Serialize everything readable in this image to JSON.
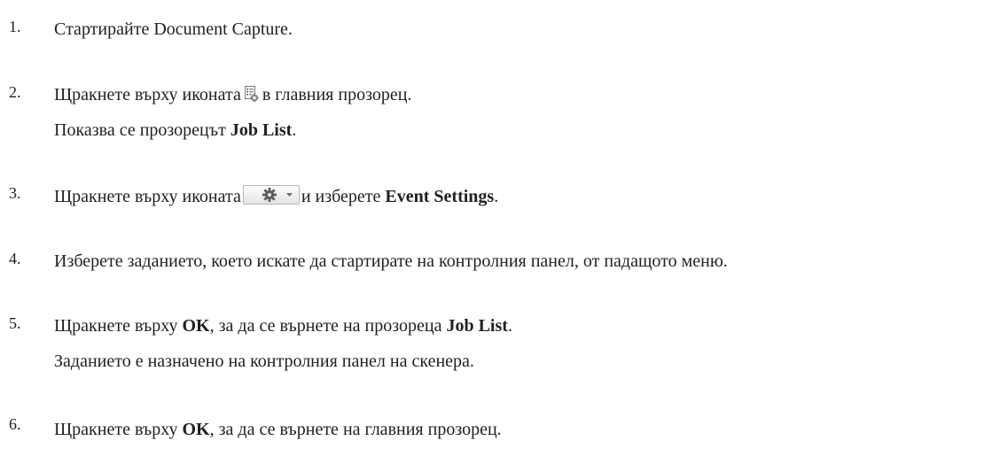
{
  "steps": [
    {
      "number": "1.",
      "text": "Стартирайте Document Capture."
    },
    {
      "number": "2.",
      "line1": {
        "before": "Щракнете върху иконата",
        "icon": "job-list-icon",
        "after": "в главния прозорец."
      },
      "line2": {
        "before": "Показва се прозорецът ",
        "bold": "Job List",
        "after": "."
      }
    },
    {
      "number": "3.",
      "line1": {
        "before": "Щракнете върху иконата",
        "icon": "gear-dropdown-icon",
        "after_plain": "и изберете ",
        "bold": "Event Settings",
        "after": "."
      }
    },
    {
      "number": "4.",
      "text": "Изберете заданието, което искате да стартирате на контролния панел, от падащото меню."
    },
    {
      "number": "5.",
      "line1": {
        "before": "Щракнете върху ",
        "bold1": "OK",
        "middle": ", за да се върнете на прозореца ",
        "bold2": "Job List",
        "after": "."
      },
      "line2": {
        "text": "Заданието е назначено на контролния панел на скенера."
      }
    },
    {
      "number": "6.",
      "line1": {
        "before": "Щракнете върху ",
        "bold": "OK",
        "after": ", за да се върнете на главния прозорец."
      }
    }
  ]
}
